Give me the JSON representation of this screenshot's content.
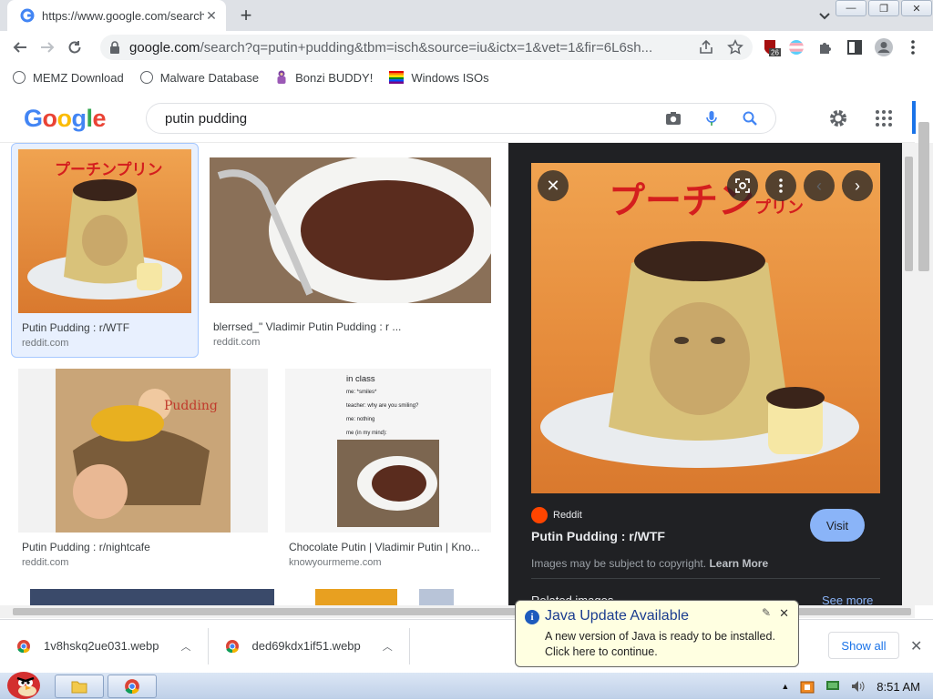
{
  "browser": {
    "tab_title": "https://www.google.com/search",
    "url_host": "google.com",
    "url_path": "/search?q=putin+pudding&tbm=isch&source=iu&ictx=1&vet=1&fir=6L6sh...",
    "ext_badge": "26"
  },
  "bookmarks": [
    {
      "label": "MEMZ Download"
    },
    {
      "label": "Malware Database"
    },
    {
      "label": "Bonzi BUDDY!"
    },
    {
      "label": "Windows ISOs"
    }
  ],
  "google": {
    "logo": "Google",
    "query": "putin pudding"
  },
  "results": [
    {
      "title": "Putin Pudding : r/WTF",
      "site": "reddit.com"
    },
    {
      "title": "blerrsed_\" Vladimir Putin Pudding : r ...",
      "site": "reddit.com"
    },
    {
      "title": "Putin Pudding : r/nightcafe",
      "site": "reddit.com"
    },
    {
      "title": "Chocolate Putin | Vladimir Putin | Kno...",
      "site": "knowyourmeme.com"
    }
  ],
  "meme_text": {
    "line1": "in class",
    "line2": "me: *smiles*",
    "line3": "teacher: why are you smiling?",
    "line4": "me: nothing",
    "line5": "me (in my mind):"
  },
  "thumb_text": {
    "pudding_jp": "プーチンプリン",
    "pudding_en": "Pudding"
  },
  "preview": {
    "image_text_main": "プーチン",
    "image_text_small": "プリン",
    "source": "Reddit",
    "title": "Putin Pudding : r/WTF",
    "visit": "Visit",
    "note": "Images may be subject to copyright.",
    "learn_more": "Learn More",
    "related": "Related images",
    "see_more": "See more"
  },
  "downloads": [
    {
      "name": "1v8hskq2ue031.webp"
    },
    {
      "name": "ded69kdx1if51.webp"
    }
  ],
  "download_bar": {
    "show_all": "Show all"
  },
  "java_balloon": {
    "title": "Java Update Available",
    "line1": "A new version of Java is ready to be installed.",
    "line2": "Click here to continue."
  },
  "taskbar": {
    "time": "8:51 AM"
  },
  "colors": {
    "google_blue": "#4285f4",
    "google_red": "#ea4335",
    "google_yellow": "#fbbc05",
    "google_green": "#34a853",
    "link_blue": "#1a73e8",
    "preview_bg": "#202124"
  }
}
